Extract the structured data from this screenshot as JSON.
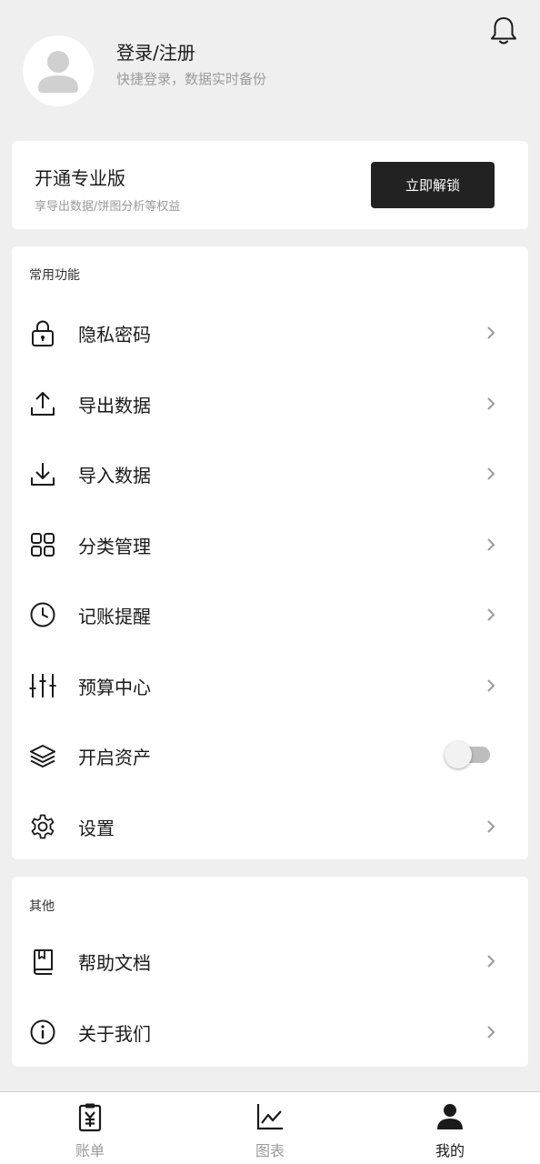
{
  "header": {
    "login_title": "登录/注册",
    "login_subtitle": "快捷登录，数据实时备份",
    "notification_icon": "bell-icon",
    "avatar_icon": "user-avatar-icon"
  },
  "pro": {
    "title": "开通专业版",
    "subtitle": "享导出数据/饼图分析等权益",
    "button_label": "立即解锁"
  },
  "common": {
    "section_title": "常用功能",
    "items": [
      {
        "label": "隐私密码",
        "icon": "lock-icon"
      },
      {
        "label": "导出数据",
        "icon": "upload-icon"
      },
      {
        "label": "导入数据",
        "icon": "download-icon"
      },
      {
        "label": "分类管理",
        "icon": "grid-icon"
      },
      {
        "label": "记账提醒",
        "icon": "clock-icon"
      },
      {
        "label": "预算中心",
        "icon": "sliders-icon"
      },
      {
        "label": "开启资产",
        "icon": "layers-icon",
        "toggle": false
      },
      {
        "label": "设置",
        "icon": "gear-icon"
      }
    ]
  },
  "other": {
    "section_title": "其他",
    "items": [
      {
        "label": "帮助文档",
        "icon": "book-icon"
      },
      {
        "label": "关于我们",
        "icon": "info-icon"
      }
    ]
  },
  "tabbar": {
    "tabs": [
      {
        "label": "账单",
        "icon": "bill-icon",
        "active": false
      },
      {
        "label": "图表",
        "icon": "chart-icon",
        "active": false
      },
      {
        "label": "我的",
        "icon": "user-icon",
        "active": true
      }
    ]
  },
  "colors": {
    "background": "#efefef",
    "card": "#ffffff",
    "primary_button": "#222222",
    "muted_text": "#9a9a9a"
  }
}
